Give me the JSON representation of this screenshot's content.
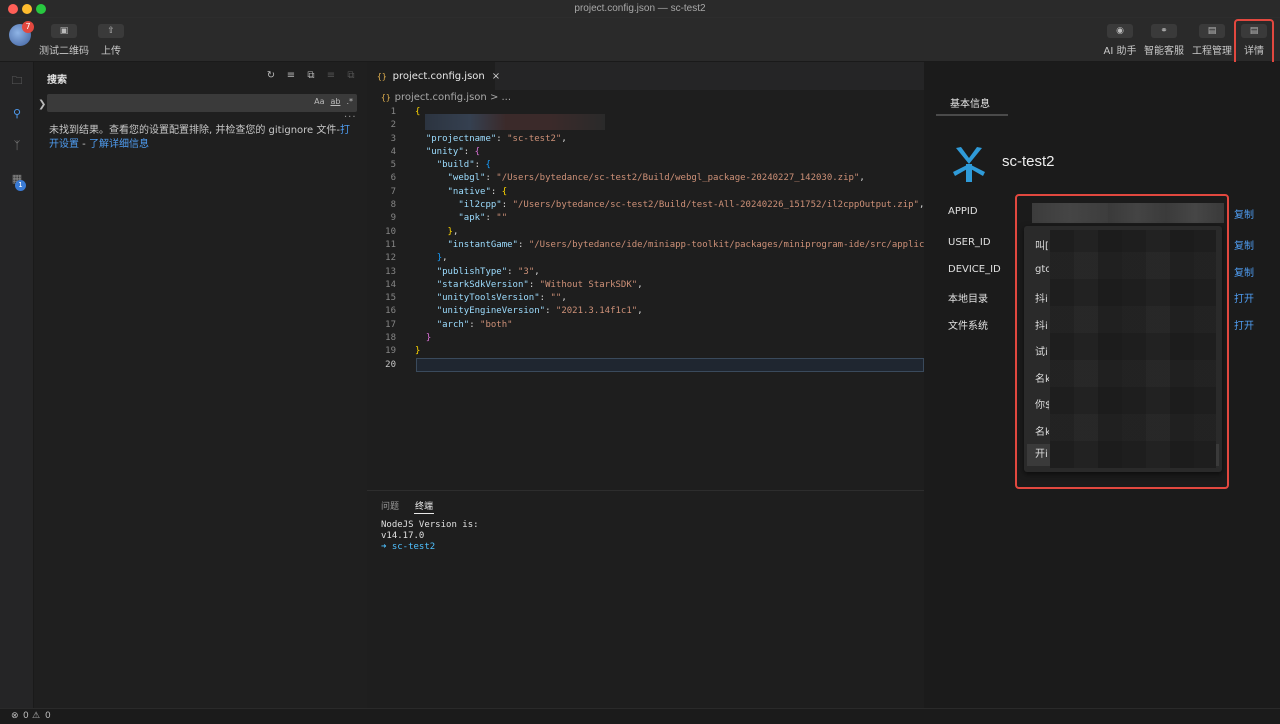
{
  "window": {
    "title": "project.config.json — sc-test2"
  },
  "toolbar": {
    "avatar_badge": "7",
    "left_buttons": [
      {
        "label": "测试二维码",
        "icon": "qrcode-icon"
      },
      {
        "label": "上传",
        "icon": "cloud-upload-icon"
      }
    ],
    "right_buttons": [
      {
        "label": "AI 助手",
        "icon": "robot-icon"
      },
      {
        "label": "智能客服",
        "icon": "headset-icon"
      },
      {
        "label": "工程管理",
        "icon": "clipboard-icon"
      },
      {
        "label": "详情",
        "icon": "document-icon"
      }
    ]
  },
  "activity": {
    "search_badge": "1"
  },
  "sidebar": {
    "title": "搜索",
    "search": {
      "value": ""
    },
    "search_options": [
      "Aa",
      "ab",
      ".*"
    ],
    "no_result": {
      "text": "未找到结果。查看您的设置配置排除, 并检查您的 gitignore 文件-",
      "link_open": "打开设置",
      "separator": " - ",
      "link_learn": "了解详细信息"
    }
  },
  "editor": {
    "tab": {
      "name": "project.config.json",
      "close": "×"
    },
    "breadcrumb": {
      "file": "project.config.json",
      "rest": "> ..."
    },
    "json_icon": "{}",
    "lines": [
      {
        "n": "1"
      },
      {
        "n": "2"
      },
      {
        "n": "3"
      },
      {
        "n": "4"
      },
      {
        "n": "5"
      },
      {
        "n": "6"
      },
      {
        "n": "7"
      },
      {
        "n": "8"
      },
      {
        "n": "9"
      },
      {
        "n": "10"
      },
      {
        "n": "11"
      },
      {
        "n": "12"
      },
      {
        "n": "13"
      },
      {
        "n": "14"
      },
      {
        "n": "15"
      },
      {
        "n": "16"
      },
      {
        "n": "17"
      },
      {
        "n": "18"
      },
      {
        "n": "19"
      },
      {
        "n": "20"
      }
    ],
    "code": {
      "projectname_key": "\"projectname\"",
      "projectname_val": "\"sc-test2\"",
      "unity_key": "\"unity\"",
      "build_key": "\"build\"",
      "webgl_key": "\"webgl\"",
      "webgl_val": "\"/Users/bytedance/sc-test2/Build/webgl_package-20240227_142030.zip\"",
      "native_key": "\"native\"",
      "il2cpp_key": "\"il2cpp\"",
      "il2cpp_val": "\"/Users/bytedance/sc-test2/Build/test-All-20240226_151752/il2cppOutput.zip\"",
      "apk_key": "\"apk\"",
      "apk_val": "\"\"",
      "instantgame_key": "\"instantGame\"",
      "instantgame_val": "\"/Users/bytedance/ide/miniapp-toolkit/packages/miniprogram-ide/src/applica",
      "publishtype_key": "\"publishType\"",
      "publishtype_val": "\"3\"",
      "starksdk_key": "\"starkSdkVersion\"",
      "starksdk_val": "\"Without StarkSDK\"",
      "unitytools_key": "\"unityToolsVersion\"",
      "unitytools_val": "\"\"",
      "unityengine_key": "\"unityEngineVersion\"",
      "unityengine_val": "\"2021.3.14f1c1\"",
      "arch_key": "\"arch\"",
      "arch_val": "\"both\""
    }
  },
  "panel": {
    "tabs": [
      "问题",
      "终端"
    ],
    "terminal": {
      "line1": "NodeJS Version is:",
      "line2": "v14.17.0",
      "prompt": "➜",
      "dir": "sc-test2"
    }
  },
  "details": {
    "tab": "基本信息",
    "project_name": "sc-test2",
    "rows": [
      {
        "label": "APPID",
        "action": "复制"
      },
      {
        "label": "USER_ID",
        "action": "复制"
      },
      {
        "label": "DEVICE_ID",
        "action": "复制"
      },
      {
        "label": "本地目录",
        "action": "打开"
      },
      {
        "label": "文件系统",
        "action": "打开"
      }
    ],
    "dropdown_items": [
      "叫[",
      "gtc",
      "抖i",
      "抖i",
      "试i",
      "名k",
      "你$",
      "名k",
      "开i"
    ]
  },
  "status": {
    "errors": "0",
    "warnings": "0"
  },
  "colors": {
    "accent": "#4f9cf0",
    "highlight": "#e2483f",
    "logo": "#2f9bd9"
  }
}
